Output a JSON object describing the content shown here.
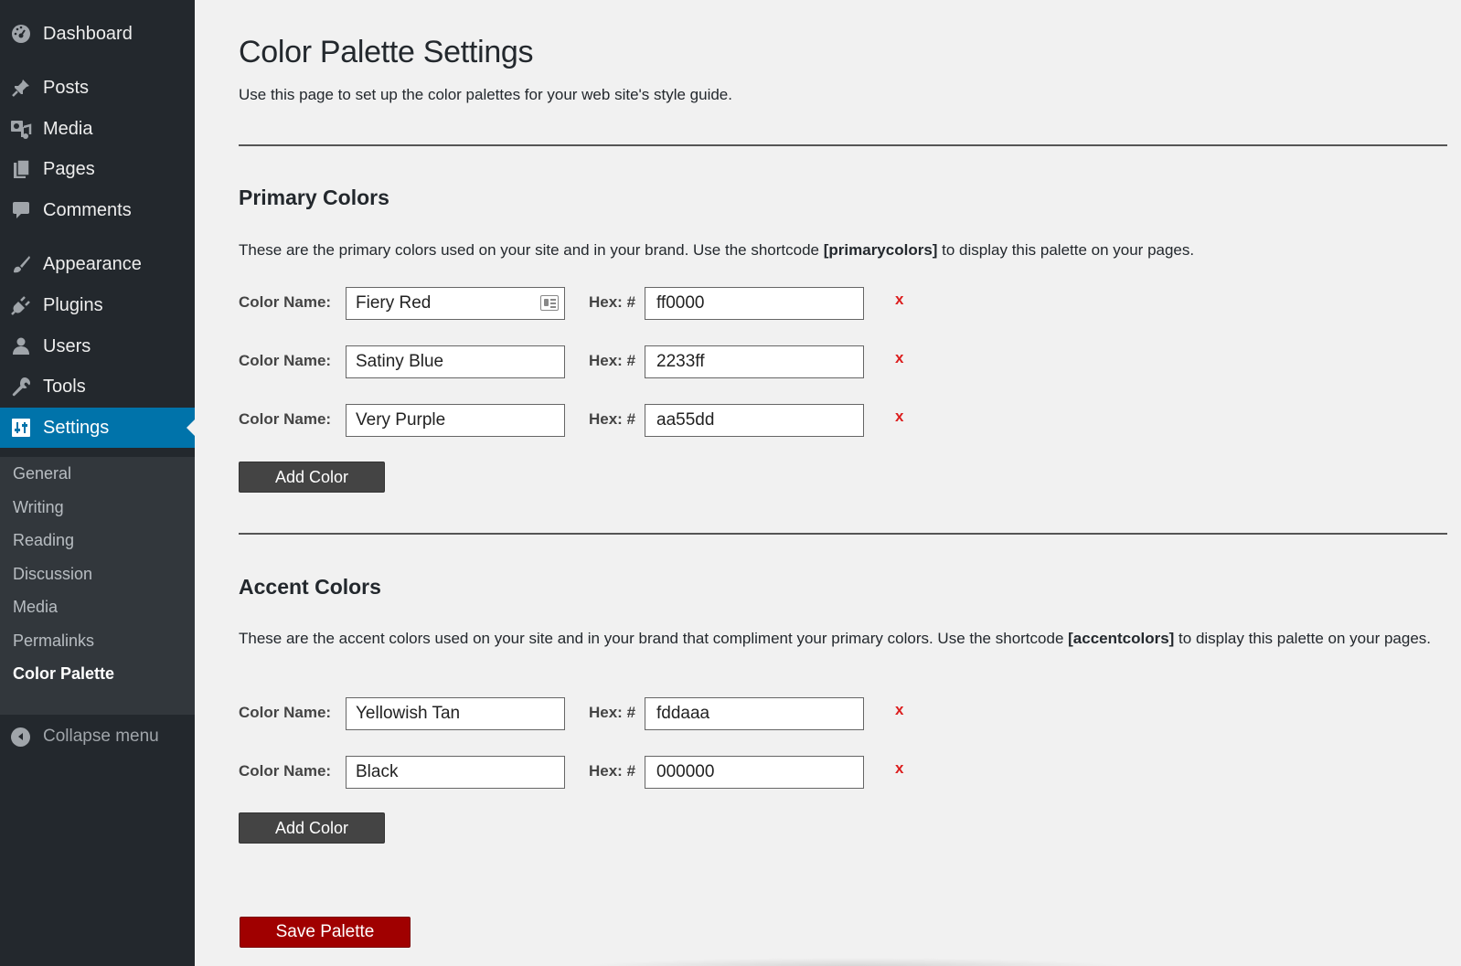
{
  "sidebar": {
    "menu": [
      {
        "label": "Dashboard",
        "icon": "dashboard-icon"
      },
      {
        "label": "Posts",
        "icon": "pin-icon"
      },
      {
        "label": "Media",
        "icon": "media-icon"
      },
      {
        "label": "Pages",
        "icon": "pages-icon"
      },
      {
        "label": "Comments",
        "icon": "comment-icon"
      },
      {
        "label": "Appearance",
        "icon": "brush-icon"
      },
      {
        "label": "Plugins",
        "icon": "plugin-icon"
      },
      {
        "label": "Users",
        "icon": "user-icon"
      },
      {
        "label": "Tools",
        "icon": "wrench-icon"
      },
      {
        "label": "Settings",
        "icon": "settings-icon"
      }
    ],
    "submenu": [
      "General",
      "Writing",
      "Reading",
      "Discussion",
      "Media",
      "Permalinks",
      "Color Palette"
    ],
    "collapse_label": "Collapse menu"
  },
  "page": {
    "title": "Color Palette Settings",
    "intro": "Use this page to set up the color palettes for your web site's style guide."
  },
  "primary": {
    "heading": "Primary Colors",
    "desc_before": "These are the primary colors used on your site and in your brand. Use the shortcode ",
    "shortcode": "[primarycolors]",
    "desc_after": " to display this palette on your pages.",
    "rows": [
      {
        "name": "Fiery Red",
        "hex": "ff0000"
      },
      {
        "name": "Satiny Blue",
        "hex": "2233ff"
      },
      {
        "name": "Very Purple",
        "hex": "aa55dd"
      }
    ],
    "add_label": "Add Color"
  },
  "accent": {
    "heading": "Accent Colors",
    "desc_before": "These are the accent colors used on your site and in your brand that compliment your primary colors. Use the shortcode ",
    "shortcode": "[accentcolors]",
    "desc_after": " to display this palette on your pages.",
    "rows": [
      {
        "name": "Yellowish Tan",
        "hex": "fddaaa"
      },
      {
        "name": "Black",
        "hex": "000000"
      }
    ],
    "add_label": "Add Color"
  },
  "labels": {
    "color_name": "Color Name:",
    "hex": "Hex: #",
    "remove": "x"
  },
  "save_label": "Save Palette",
  "colors": {
    "sidebar_bg": "#23282d",
    "submenu_bg": "#32373c",
    "active_bg": "#0073aa",
    "save_bg": "#a00000",
    "remove": "#dc1e1e"
  }
}
